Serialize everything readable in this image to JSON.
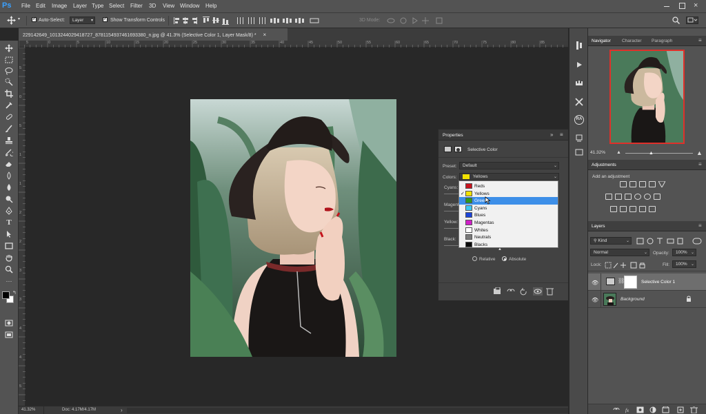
{
  "app": {
    "logo": "Ps"
  },
  "menu": [
    "File",
    "Edit",
    "Image",
    "Layer",
    "Type",
    "Select",
    "Filter",
    "3D",
    "View",
    "Window",
    "Help"
  ],
  "options": {
    "auto_select_label": "Auto-Select:",
    "auto_select_value": "Layer",
    "transform_label": "Show Transform Controls",
    "mode_3d": "3D Mode:"
  },
  "document": {
    "tab_title": "229142649_1013244029418727_8781154937461693380_n.jpg @ 41.3% (Selective Color 1, Layer Mask/8) *",
    "tab_close": "×"
  },
  "ruler": {
    "top": [
      "5",
      "0",
      "5",
      "10",
      "15",
      "20",
      "25",
      "30",
      "35",
      "40",
      "45",
      "50",
      "55",
      "60",
      "65",
      "70",
      "75",
      "80",
      "85"
    ],
    "left": [
      "5",
      "0",
      "5",
      "1",
      "1",
      "2",
      "2",
      "3",
      "3",
      "4",
      "4",
      "5",
      "5"
    ]
  },
  "status": {
    "zoom": "41.32%",
    "doc": "Doc: 4.17M/4.17M",
    "arrow": "›"
  },
  "properties": {
    "tab": "Properties",
    "title": "Selective Color",
    "preset_label": "Preset:",
    "preset_value": "Default",
    "colors_label": "Colors:",
    "colors_value": "Yellows",
    "sliders": [
      "Cyans:",
      "Magenta:",
      "Yellow:",
      "Black:"
    ],
    "method_relative": "Relative",
    "method_absolute": "Absolute",
    "method_selected": "Absolute"
  },
  "color_options": [
    {
      "label": "Reds",
      "color": "#c8141e"
    },
    {
      "label": "Yellows",
      "color": "#f2e200",
      "checked": true
    },
    {
      "label": "Greens",
      "color": "#2e9a1a",
      "highlighted": true
    },
    {
      "label": "Cyans",
      "color": "#40c8f0"
    },
    {
      "label": "Blues",
      "color": "#1c44d8"
    },
    {
      "label": "Magentas",
      "color": "#d020c8"
    },
    {
      "label": "Whites",
      "color": "#ffffff"
    },
    {
      "label": "Neutrals",
      "color": "#7a7a7a"
    },
    {
      "label": "Blacks",
      "color": "#0a0a0a"
    }
  ],
  "navigator": {
    "tabs": [
      "Navigator",
      "Character",
      "Paragraph"
    ],
    "zoom": "41.32%"
  },
  "adjustments": {
    "tab": "Adjustments",
    "hint": "Add an adjustment"
  },
  "layers": {
    "tab": "Layers",
    "filter_kind": "Kind",
    "blend_mode": "Normal",
    "opacity_label": "Opacity:",
    "opacity_value": "100%",
    "lock_label": "Lock:",
    "fill_label": "Fill:",
    "fill_value": "100%",
    "items": [
      {
        "name": "Selective Color 1",
        "selected": true
      },
      {
        "name": "Background",
        "locked": true
      }
    ]
  },
  "colors": {
    "accent": "#3d8fe8",
    "panel": "#535353",
    "navigator_frame": "#e0302a"
  },
  "dock_icons": [
    "history-icon",
    "play-icon",
    "swatches-icon",
    "tools-icon",
    "ra-plugin-icon",
    "libraries-icon",
    "brush-settings-icon"
  ]
}
